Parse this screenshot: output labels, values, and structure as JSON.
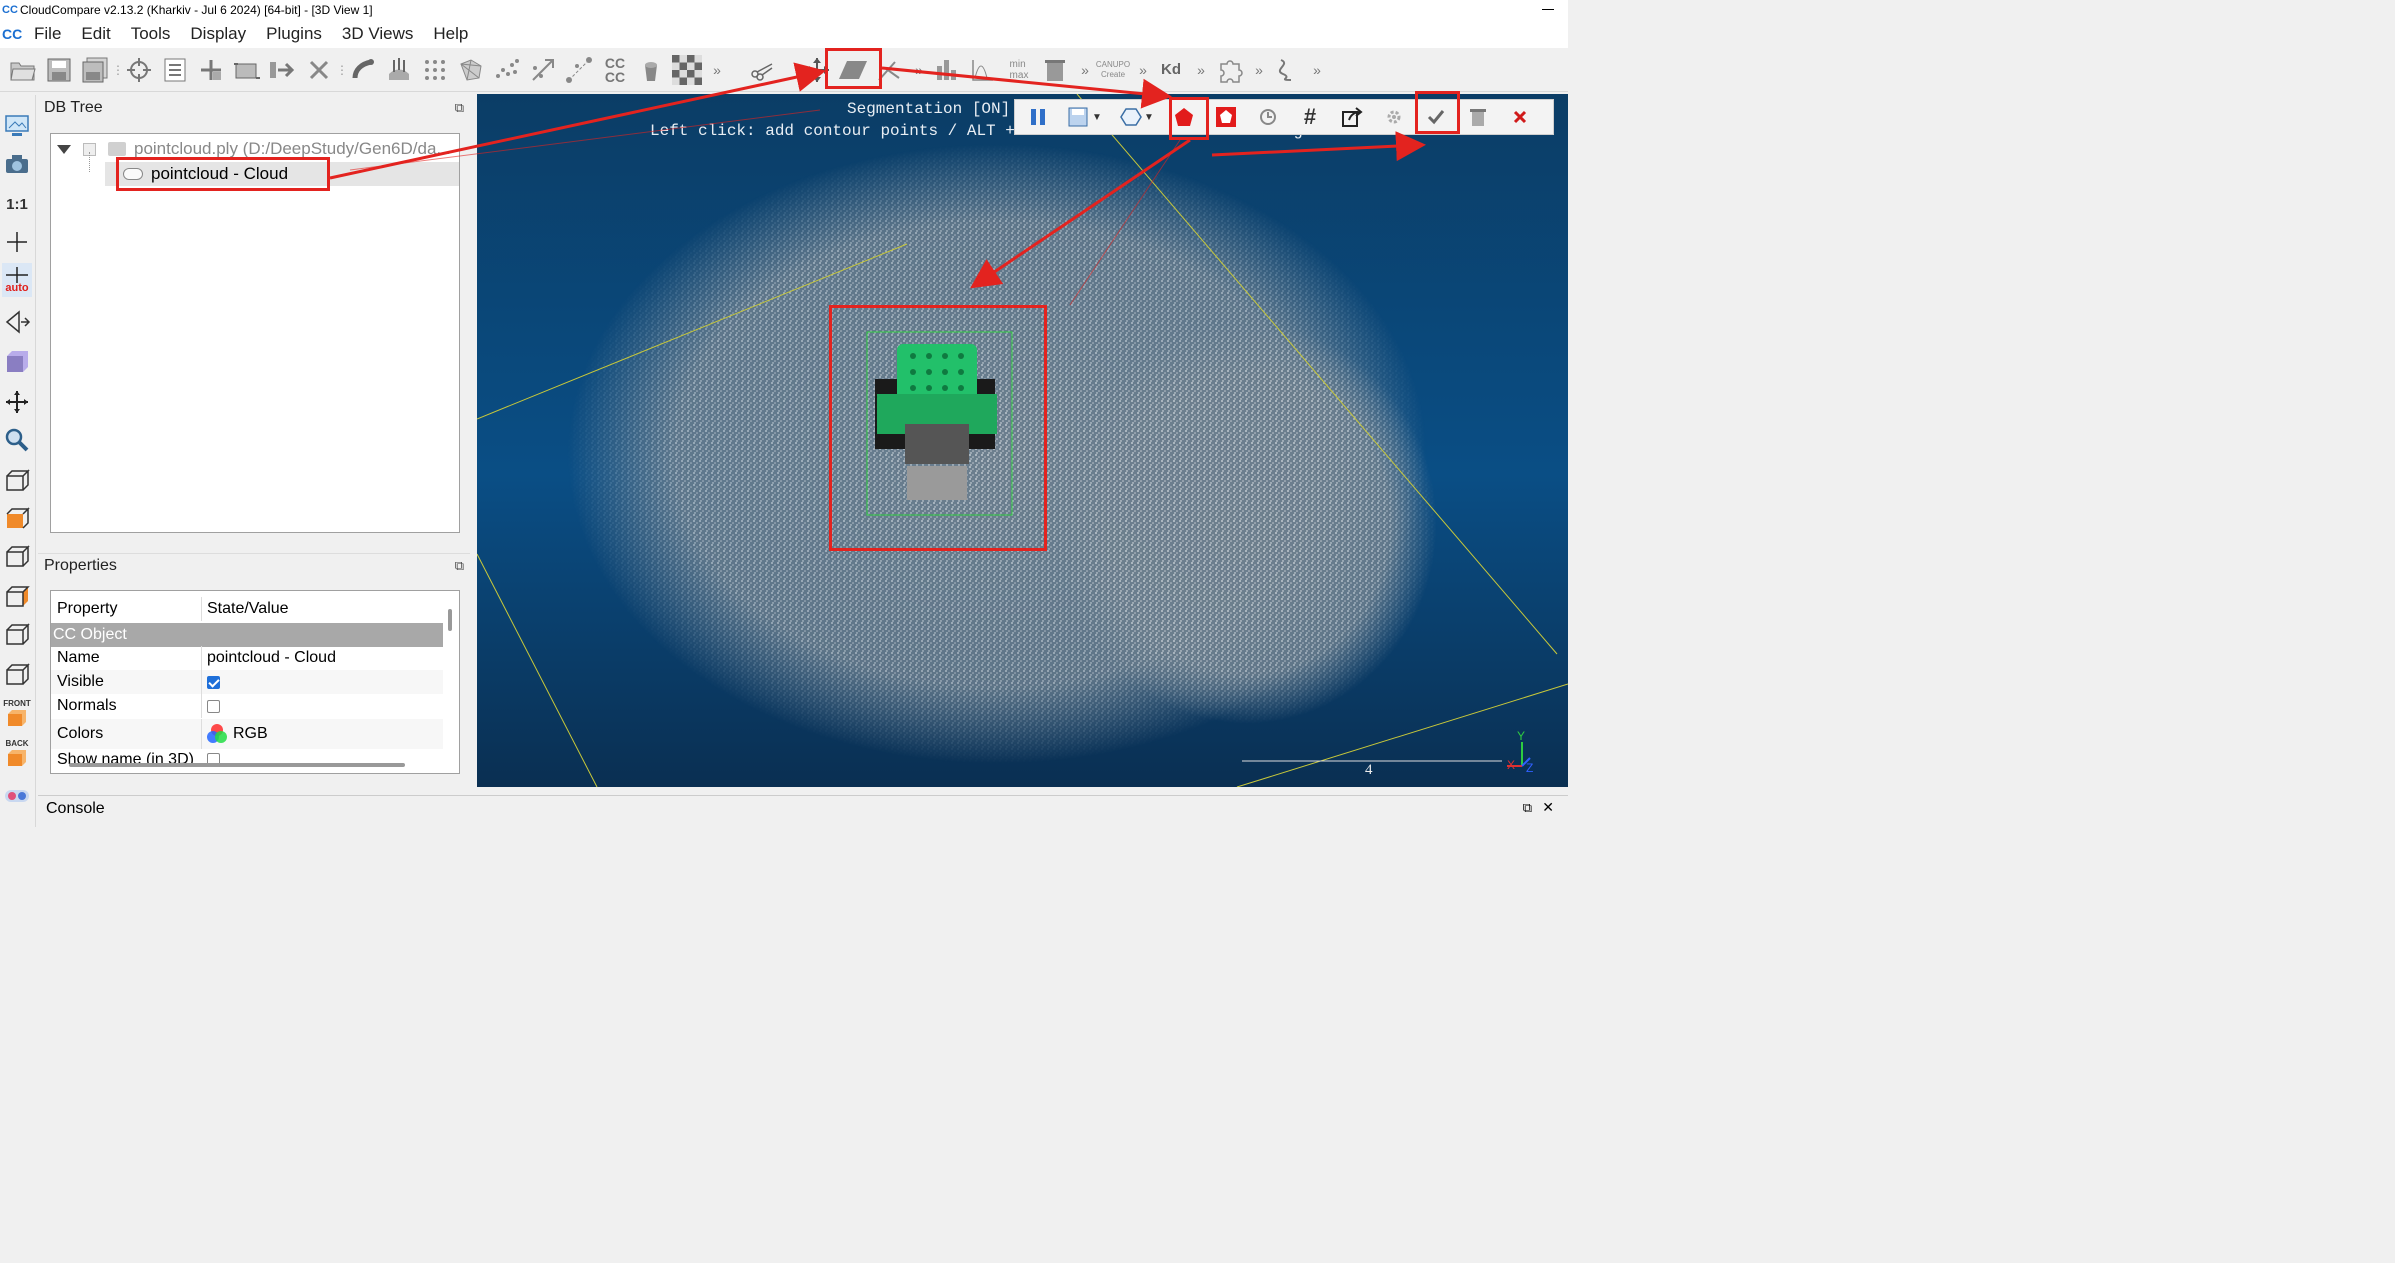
{
  "window": {
    "title": "CloudCompare v2.13.2 (Kharkiv - Jul  6 2024) [64-bit] - [3D View 1]",
    "app_logo": "CC"
  },
  "menu": [
    "File",
    "Edit",
    "Tools",
    "Display",
    "Plugins",
    "3D Views",
    "Help"
  ],
  "toolbar": {
    "icons": [
      "open-icon",
      "save-icon",
      "save-all-icon",
      "picking-icon",
      "list-icon",
      "translate-icon",
      "crop-icon",
      "merge-icon",
      "delete-icon",
      "sample-icon",
      "normals-icon",
      "subsample-icon",
      "mesh-icon",
      "noise-icon",
      "scale-icon",
      "distance-icon",
      "cc-compare-icon",
      "bucket-icon",
      "checker-icon",
      "segment-scissors-icon",
      "move-icon",
      "plane-icon",
      "level-icon",
      "histogram-icon",
      "stats-icon",
      "min-max-icon",
      "trash-icon",
      "canupo-create-icon",
      "kd-tree-icon",
      "puzzle-icon",
      "line-icon"
    ],
    "labels": {
      "cc_compare": "CC\nCC",
      "min_max": "min\nmax",
      "canupo": "CANUPO\nCreate",
      "kd": "Kd"
    }
  },
  "left_toolbar": {
    "one_to_one": "1:1",
    "auto": "auto",
    "front": "FRONT",
    "back": "BACK"
  },
  "dbtree": {
    "title": "DB Tree",
    "root_label": "pointcloud.ply (D:/DeepStudy/Gen6D/da...",
    "child_label": "pointcloud - Cloud"
  },
  "properties": {
    "title": "Properties",
    "header_property": "Property",
    "header_value": "State/Value",
    "section": "CC Object",
    "rows": [
      {
        "key": "Name",
        "value": "pointcloud - Cloud"
      },
      {
        "key": "Visible",
        "value": ""
      },
      {
        "key": "Normals",
        "value": ""
      },
      {
        "key": "Colors",
        "value": "RGB"
      },
      {
        "key": "Show name (in 3D)",
        "value": ""
      }
    ],
    "visible_checked": true,
    "normals_checked": false
  },
  "view3d": {
    "seg_line1": "Segmentation [ON] (",
    "seg_line2": "Left click: add contour points / ALT + left click: remove last / Right click: close",
    "scale_value": "4",
    "axis_y": "Y",
    "axis_x": "X",
    "axis_z": "Z",
    "colors": {
      "bg_top": "#0b3d66",
      "bg_bottom": "#0a2f52",
      "object_green": "#22c06a",
      "annotation_red": "#e3231f"
    }
  },
  "segmentation_toolbar": {
    "icons": [
      "pause-icon",
      "export-icon",
      "polygon-select-icon",
      "segment-in-icon",
      "segment-out-icon",
      "classify-icon",
      "grid-icon",
      "export-segment-icon",
      "settings-icon",
      "confirm-icon",
      "confirm-delete-icon",
      "cancel-icon"
    ]
  },
  "console": {
    "title": "Console"
  }
}
